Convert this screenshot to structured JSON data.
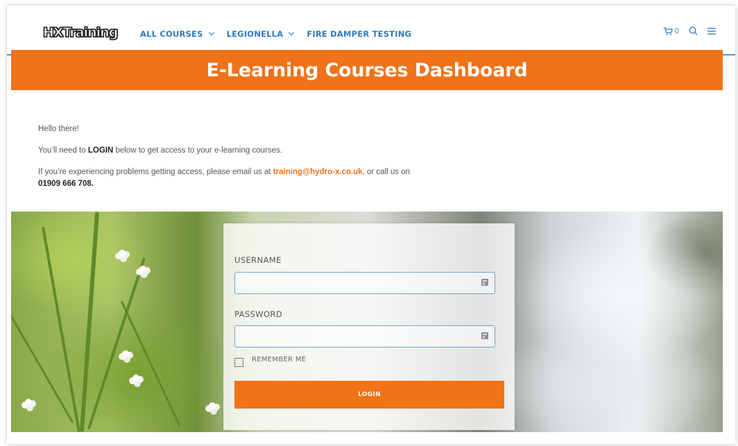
{
  "header": {
    "logo_text": "HXTraining",
    "nav": [
      {
        "label": "ALL COURSES",
        "has_dropdown": true
      },
      {
        "label": "LEGIONELLA",
        "has_dropdown": true
      },
      {
        "label": "FIRE DAMPER TESTING",
        "has_dropdown": false
      }
    ],
    "cart_count": "0",
    "icons": [
      "cart-icon",
      "search-icon",
      "menu-icon"
    ],
    "accent_color": "#2c7ac2"
  },
  "banner": {
    "title": "E-Learning Courses Dashboard",
    "color": "#f07219"
  },
  "intro": {
    "greeting": "Hello there!",
    "line2_pre": "You’ll need to ",
    "line2_bold": "LOGIN",
    "line2_post": " below to get access to your e-learning courses.",
    "line3_pre": "If you’re experiencing problems getting access, please email us at ",
    "email": "training@hydro-x.co.uk",
    "line3_post": ", or call us on",
    "phone": "01909 666 708."
  },
  "login": {
    "username_label": "USERNAME",
    "username_value": "",
    "password_label": "PASSWORD",
    "password_value": "",
    "remember_label": "REMEMBER ME",
    "remember_checked": false,
    "button_label": "LOGIN"
  }
}
